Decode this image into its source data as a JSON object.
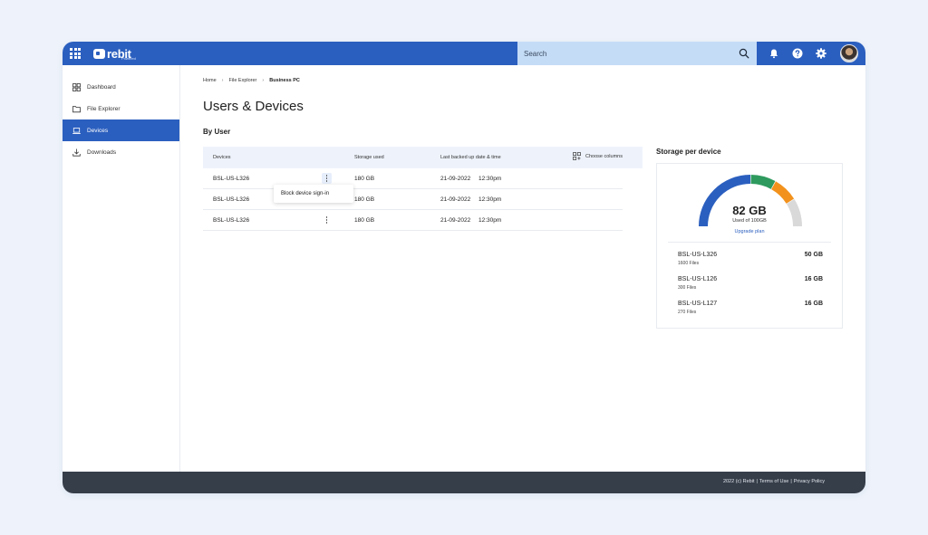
{
  "app": {
    "logo_text": "rebit",
    "logo_sub": "Powered"
  },
  "topbar": {
    "search_placeholder": "Search",
    "icons": [
      "apps-grid-icon",
      "search-icon",
      "bell-icon",
      "help-icon",
      "gear-icon"
    ],
    "color": "#2b5fbf"
  },
  "sidebar": {
    "items": [
      {
        "label": "Dashboard",
        "icon": "dashboard-icon",
        "active": false
      },
      {
        "label": "File Explorer",
        "icon": "folder-icon",
        "active": false
      },
      {
        "label": "Devices",
        "icon": "laptop-icon",
        "active": true
      },
      {
        "label": "Downloads",
        "icon": "download-icon",
        "active": false
      }
    ]
  },
  "breadcrumb": [
    "Home",
    "File Explorer",
    "Business PC"
  ],
  "main": {
    "title": "Users & Devices",
    "section": "By User"
  },
  "table": {
    "columns": [
      "Devices",
      "Storage used",
      "Last backed up date & time"
    ],
    "choose_columns": "Choose columns",
    "rows": [
      {
        "device": "BSL-US-L326",
        "storage": "180 GB",
        "date": "21-09-2022",
        "time": "12:30pm"
      },
      {
        "device": "BSL-US-L326",
        "storage": "180 GB",
        "date": "21-09-2022",
        "time": "12:30pm"
      },
      {
        "device": "BSL-US-L326",
        "storage": "180 GB",
        "date": "21-09-2022",
        "time": "12:30pm"
      }
    ],
    "row_menu": {
      "item": "Block device sign-in"
    }
  },
  "storage": {
    "title": "Storage per device",
    "used_value": "82 GB",
    "used_label": "Used of 100GB",
    "used_fraction": 0.82,
    "upgrade_label": "Upgrade plan",
    "segments": [
      {
        "color": "#2b5fbf",
        "fraction": 0.5
      },
      {
        "color": "#2e9a5e",
        "fraction": 0.16
      },
      {
        "color": "#f2921d",
        "fraction": 0.16
      },
      {
        "color": "#d9d9d9",
        "fraction": 0.18
      }
    ],
    "devices": [
      {
        "name": "BSL-US-L326",
        "files": "1600 Files",
        "size": "50 GB"
      },
      {
        "name": "BSL-US-L126",
        "files": "300 Files",
        "size": "16 GB"
      },
      {
        "name": "BSL-US-L127",
        "files": "270 Files",
        "size": "16 GB"
      }
    ]
  },
  "footer": {
    "copyright": "2022 (c) Rebit",
    "terms": "Terms of Use",
    "privacy": "Privacy Policy",
    "separator": "|"
  }
}
